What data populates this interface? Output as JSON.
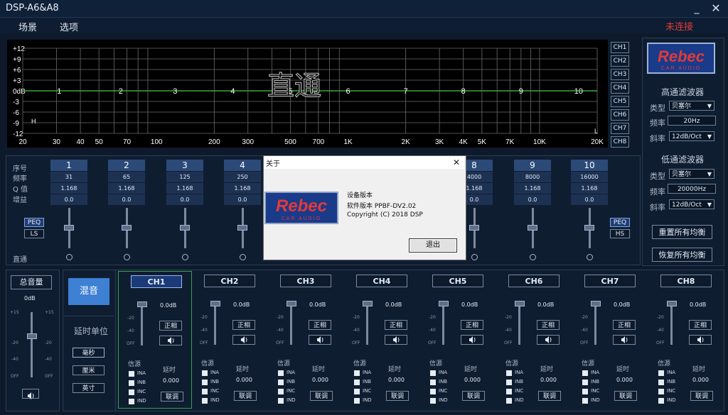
{
  "window": {
    "title": "DSP-A6&A8",
    "min_glyph": "_",
    "close_glyph": "✕"
  },
  "menu": [
    {
      "label": "场景"
    },
    {
      "label": "选项"
    }
  ],
  "connection_status": "未连接",
  "colors": {
    "accent": "#3d80d4",
    "status_error": "#e23a3a",
    "curve": "#3aa83a",
    "selected_channel_border": "#36a14a"
  },
  "graph": {
    "y_ticks": [
      "+12",
      "+9",
      "+6",
      "+3",
      "0dB",
      "-3",
      "-6",
      "-9",
      "-12"
    ],
    "x_ticks": [
      "20",
      "30",
      "40",
      "50",
      "70",
      "100",
      "200",
      "300",
      "500",
      "700",
      "1K",
      "2K",
      "3K",
      "4K",
      "5K",
      "7K",
      "10K",
      "20K"
    ],
    "mode_label": "直通",
    "band_markers": [
      "1",
      "2",
      "3",
      "4",
      "5",
      "6",
      "7",
      "8",
      "9",
      "10"
    ],
    "h_marker": "H",
    "l_marker": "L"
  },
  "channel_tabs": [
    "CH1",
    "CH2",
    "CH3",
    "CH4",
    "CH5",
    "CH6",
    "CH7",
    "CH8"
  ],
  "brand": {
    "name": "Rebec",
    "sub": "CAR AUDIO"
  },
  "highpass": {
    "title": "高通滤波器",
    "type_label": "类型",
    "type_value": "贝塞尔",
    "freq_label": "频率",
    "freq_value": "20Hz",
    "slope_label": "斜率",
    "slope_value": "12dB/Oct"
  },
  "lowpass": {
    "title": "低通滤波器",
    "type_label": "类型",
    "type_value": "贝塞尔",
    "freq_label": "频率",
    "freq_value": "20000Hz",
    "slope_label": "斜率",
    "slope_value": "12dB/Oct"
  },
  "reset_eq_label": "重置所有均衡",
  "restore_eq_label": "恢复所有均衡",
  "eq": {
    "row_labels": {
      "index": "序号",
      "freq": "频率",
      "q": "Q 值",
      "gain": "增益",
      "bypass": "直通"
    },
    "peq_label": "PEQ",
    "ls_label": "LS",
    "hs_label": "HS",
    "bands": [
      {
        "num": "1",
        "freq": "31",
        "q": "1.168",
        "gain": "0.0"
      },
      {
        "num": "2",
        "freq": "65",
        "q": "1.168",
        "gain": "0.0"
      },
      {
        "num": "3",
        "freq": "125",
        "q": "1.168",
        "gain": "0.0"
      },
      {
        "num": "4",
        "freq": "250",
        "q": "1.168",
        "gain": "0.0"
      },
      {
        "num": "5",
        "freq": "",
        "q": "",
        "gain": ""
      },
      {
        "num": "6",
        "freq": "",
        "q": "",
        "gain": ""
      },
      {
        "num": "7",
        "freq": "",
        "q": "",
        "gain": ""
      },
      {
        "num": "8",
        "freq": "4000",
        "q": "1.168",
        "gain": "0.0"
      },
      {
        "num": "9",
        "freq": "8000",
        "q": "1.168",
        "gain": "0.0"
      },
      {
        "num": "10",
        "freq": "16000",
        "q": "1.168",
        "gain": "0.0"
      }
    ]
  },
  "master": {
    "label": "总音量",
    "value": "0dB",
    "scale_top_left": "+15",
    "scale_top_right": "+15",
    "scale": [
      "-20",
      "-40",
      "OFF"
    ],
    "scale_right": [
      "-20",
      "-40",
      "OFF"
    ],
    "level": 0.62
  },
  "mix": {
    "label": "混音"
  },
  "delay_unit": {
    "label": "延时单位",
    "options": [
      "毫秒",
      "厘米",
      "英寸"
    ],
    "selected": 0
  },
  "channels": [
    {
      "name": "CH1",
      "gain": "0.0dB",
      "phase": "正相",
      "source": "信源",
      "inputs": [
        "INA",
        "INB",
        "INC",
        "IND"
      ],
      "delay_label": "延时",
      "delay": "0.000",
      "link": "联调"
    },
    {
      "name": "CH2",
      "gain": "0.0dB",
      "phase": "正相",
      "source": "信源",
      "inputs": [
        "INA",
        "INB",
        "INC",
        "IND"
      ],
      "delay_label": "延时",
      "delay": "0.000",
      "link": "联调"
    },
    {
      "name": "CH3",
      "gain": "0.0dB",
      "phase": "正相",
      "source": "信源",
      "inputs": [
        "INA",
        "INB",
        "INC",
        "IND"
      ],
      "delay_label": "延时",
      "delay": "0.000",
      "link": "联调"
    },
    {
      "name": "CH4",
      "gain": "0.0dB",
      "phase": "正相",
      "source": "信源",
      "inputs": [
        "INA",
        "INB",
        "INC",
        "IND"
      ],
      "delay_label": "延时",
      "delay": "0.000",
      "link": "联调"
    },
    {
      "name": "CH5",
      "gain": "0.0dB",
      "phase": "正相",
      "source": "信源",
      "inputs": [
        "INA",
        "INB",
        "INC",
        "IND"
      ],
      "delay_label": "延时",
      "delay": "0.000",
      "link": "联调"
    },
    {
      "name": "CH6",
      "gain": "0.0dB",
      "phase": "正相",
      "source": "信源",
      "inputs": [
        "INA",
        "INB",
        "INC",
        "IND"
      ],
      "delay_label": "延时",
      "delay": "0.000",
      "link": "联调"
    },
    {
      "name": "CH7",
      "gain": "0.0dB",
      "phase": "正相",
      "source": "信源",
      "inputs": [
        "INA",
        "INB",
        "INC",
        "IND"
      ],
      "delay_label": "延时",
      "delay": "0.000",
      "link": "联调"
    },
    {
      "name": "CH8",
      "gain": "0.0dB",
      "phase": "正相",
      "source": "信源",
      "inputs": [
        "INA",
        "INB",
        "INC",
        "IND"
      ],
      "delay_label": "延时",
      "delay": "0.000",
      "link": "联调"
    }
  ],
  "channel_scale": [
    "-20",
    "-40",
    "OFF"
  ],
  "selected_channel": 0,
  "about_dialog": {
    "title": "关于",
    "device_version": "设备版本",
    "software_version": "软件版本 PPBF-DV2.02",
    "copyright": "Copyright (C) 2018 DSP",
    "exit_label": "退出"
  },
  "icons": [
    "speaker-icon",
    "close-icon",
    "minimize-icon",
    "dropdown-arrow-icon",
    "checkbox-icon"
  ]
}
